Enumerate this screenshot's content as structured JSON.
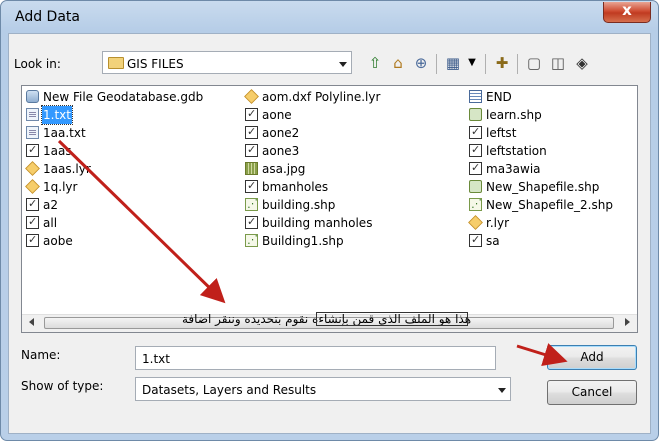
{
  "window": {
    "title": "Add Data",
    "close_symbol": "x"
  },
  "toolbar": {
    "look_in_label": "Look in:",
    "look_in_value": "GIS FILES",
    "icons": [
      "up-one-level-icon",
      "home-icon",
      "connect-folder-icon",
      "view-list-icon",
      "view-dropdown-icon",
      "new-folder-icon",
      "catalog-icon",
      "toolbox-icon",
      "add-to-map-icon"
    ]
  },
  "files": [
    {
      "name": "New File Geodatabase.gdb",
      "icon": "geodatabase"
    },
    {
      "name": "1.txt",
      "icon": "text",
      "selected": true
    },
    {
      "name": "1aa.txt",
      "icon": "text"
    },
    {
      "name": "1aas",
      "icon": "checkbox"
    },
    {
      "name": "1aas.lyr",
      "icon": "layer"
    },
    {
      "name": "1q.lyr",
      "icon": "layer"
    },
    {
      "name": "a2",
      "icon": "checkbox"
    },
    {
      "name": "all",
      "icon": "checkbox"
    },
    {
      "name": "aobe",
      "icon": "checkbox"
    },
    {
      "name": "aom.dxf Polyline.lyr",
      "icon": "layer"
    },
    {
      "name": "aone",
      "icon": "checkbox"
    },
    {
      "name": "aone2",
      "icon": "checkbox"
    },
    {
      "name": "aone3",
      "icon": "checkbox"
    },
    {
      "name": "asa.jpg",
      "icon": "raster"
    },
    {
      "name": "bmanholes",
      "icon": "checkbox"
    },
    {
      "name": "building.shp",
      "icon": "shapefile"
    },
    {
      "name": "building manholes",
      "icon": "checkbox"
    },
    {
      "name": "Building1.shp",
      "icon": "shapefile"
    },
    {
      "name": "END",
      "icon": "table"
    },
    {
      "name": "learn.shp",
      "icon": "shapefile-poly"
    },
    {
      "name": "leftst",
      "icon": "checkbox"
    },
    {
      "name": "leftstation",
      "icon": "checkbox"
    },
    {
      "name": "ma3awia",
      "icon": "checkbox"
    },
    {
      "name": "New_Shapefile.shp",
      "icon": "shapefile-poly"
    },
    {
      "name": "New_Shapefile_2.shp",
      "icon": "shapefile"
    },
    {
      "name": "r.lyr",
      "icon": "layer"
    },
    {
      "name": "sa",
      "icon": "checkbox"
    }
  ],
  "annotation_text": "هذا هو الملف الذي قمن بإنشاءه نقوم بتحديده وننقر اضافة",
  "form": {
    "name_label": "Name:",
    "name_value": "1.txt",
    "type_label": "Show of type:",
    "type_value": "Datasets, Layers and Results"
  },
  "buttons": {
    "add": "Add",
    "cancel": "Cancel"
  },
  "colors": {
    "selection": "#3399ff",
    "annotation_arrow": "#c0201a"
  }
}
